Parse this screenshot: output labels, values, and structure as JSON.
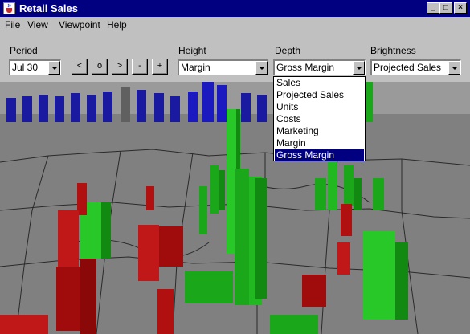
{
  "window": {
    "title": "Retail Sales",
    "buttons": {
      "minimize": "_",
      "maximize": "□",
      "close": "×"
    }
  },
  "menu": [
    "File",
    "View",
    "Viewpoint",
    "Help"
  ],
  "controls": {
    "period": {
      "label": "Period",
      "value": "Jul 30"
    },
    "nav_buttons": [
      "<",
      "o",
      ">",
      "-",
      "+"
    ],
    "height": {
      "label": "Height",
      "value": "Margin"
    },
    "depth": {
      "label": "Depth",
      "value": "Gross Margin",
      "options": [
        "Sales",
        "Projected Sales",
        "Units",
        "Costs",
        "Marketing",
        "Margin",
        "Gross Margin"
      ],
      "selected_index": 6
    },
    "brightness": {
      "label": "Brightness",
      "value": "Projected Sales"
    }
  },
  "colors": {
    "titlebar": "#000080",
    "selection": "#000080",
    "map_ground": "#808080",
    "bar_green": "#1aa81a",
    "bar_red": "#b01010",
    "bar_blue": "#1a1ac0"
  }
}
